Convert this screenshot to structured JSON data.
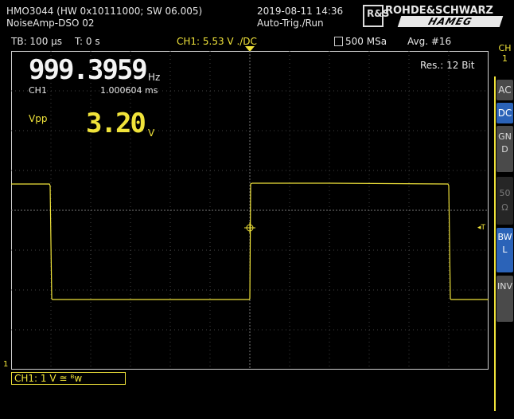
{
  "header": {
    "device": "HMO3044 (HW 0x10111000; SW 06.005)",
    "setup": "NoiseAmp-DSO 02",
    "datetime": "2019-08-11 14:36",
    "trigger_mode": "Auto-Trig./Run",
    "brand_top": "ROHDE&SCHWARZ",
    "brand_bottom": "HAMEG",
    "logo_letters": "R&S"
  },
  "status_bar": {
    "timebase": "TB: 100 µs",
    "trigger_time": "T: 0 s",
    "channel_trigger": "CH1: 5.53 V ./DC",
    "sample_rate": "500 MSa",
    "averaging": "Avg. #16"
  },
  "measurements": {
    "frequency_value": "999.3959",
    "frequency_unit": "Hz",
    "channel": "CH1",
    "period": "1.000604 ms",
    "vpp_label": "Vpp",
    "vpp_value": "3.20",
    "vpp_unit": "V",
    "resolution": "Res.: 12 Bit"
  },
  "side_menu": {
    "channel_label": "CH\n1",
    "buttons": [
      {
        "label": "AC",
        "active": false,
        "dim": false
      },
      {
        "label": "DC",
        "active": true,
        "dim": false
      },
      {
        "label": "GND",
        "active": false,
        "dim": false
      },
      {
        "label": "50Ω",
        "active": false,
        "dim": true
      },
      {
        "label": "BWL",
        "active": true,
        "dim": false
      },
      {
        "label": "INV",
        "active": false,
        "dim": false
      }
    ]
  },
  "channel_info": {
    "label": "CH1: 1 V ≅ ᴮw",
    "marker": "1",
    "trigger_marker": "T"
  },
  "colors": {
    "trace": "#f0e33a",
    "grid": "#5a5a5a",
    "active_button": "#2b63b8"
  }
}
